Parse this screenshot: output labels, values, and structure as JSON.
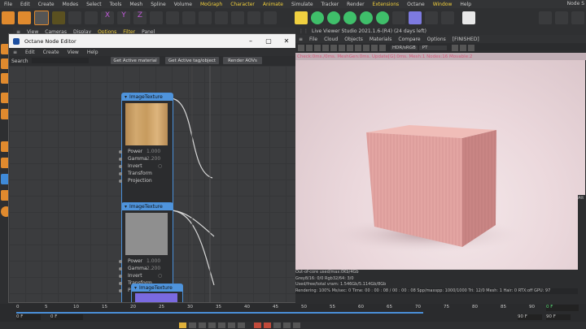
{
  "app": {
    "menu": [
      "File",
      "Edit",
      "Create",
      "Modes",
      "Select",
      "Tools",
      "Mesh",
      "Spline",
      "Volume",
      "MoGraph",
      "Character",
      "Animate",
      "Simulate",
      "Tracker",
      "Render",
      "Extensions",
      "Octane",
      "Window",
      "Help"
    ],
    "menu_highlighted": [
      "MoGraph",
      "Character",
      "Animate",
      "Extensions",
      "Window"
    ],
    "node_label": "Node S",
    "viewport_menu": [
      "View",
      "Cameras",
      "Display",
      "Options",
      "Filter",
      "Panel"
    ]
  },
  "node_editor": {
    "title": "Octane Node Editor",
    "window_buttons": [
      "–",
      "▢",
      "✕"
    ],
    "menu": [
      "Edit",
      "Create",
      "View",
      "Help"
    ],
    "search_label": "Search",
    "buttons": [
      "Get Active material",
      "Get Active tag/object",
      "Render AOVs"
    ],
    "nodes": [
      {
        "header": "ImageTexture",
        "params": [
          {
            "label": "Power",
            "value": "1.000"
          },
          {
            "label": "Gamma",
            "value": "2.200"
          },
          {
            "label": "Invert",
            "value": "○"
          },
          {
            "label": "Transform",
            "value": ""
          },
          {
            "label": "Projection",
            "value": ""
          }
        ]
      },
      {
        "header": "ImageTexture",
        "params": [
          {
            "label": "Power",
            "value": "1.000"
          },
          {
            "label": "Gamma",
            "value": "2.200"
          },
          {
            "label": "Invert",
            "value": "○"
          },
          {
            "label": "Transform",
            "value": ""
          },
          {
            "label": "P",
            "value": ""
          }
        ]
      },
      {
        "header": "ImageTexture",
        "params": []
      }
    ]
  },
  "viewer": {
    "title": "Live Viewer Studio 2021.1.6-(R4) (24 days left)",
    "menu": [
      "File",
      "Cloud",
      "Objects",
      "Materials",
      "Compare",
      "Options"
    ],
    "status_tag": "[FINISHED]",
    "colorspace": "HDR/sRGB",
    "pt": "PT",
    "check": "Check:0ms./0ms. MeshGen:0ms. Update[G]:0ms. Mesh:1 Nodes:16 Movable:2",
    "info": [
      "Out-of-core used/max:0Kb/4Gb",
      "Grey8/16: 0/0      Rgb32/64: 3/0",
      "Used/free/total vram: 1.546Gb/5.114Gb/8Gb",
      "Rendering: 100%  Ms/sec: 0   Time: 00 : 00 : 08 / 00 : 00 : 08     Spp/maxspp: 1000/1000    Tri: 12/0     Mesh: 1  Hair: 0    RTX:off     GPU:  97"
    ]
  },
  "timeline": {
    "ticks": [
      "0",
      "5",
      "10",
      "15",
      "20",
      "25",
      "30",
      "35",
      "40",
      "45",
      "50",
      "55",
      "60",
      "65",
      "70",
      "75",
      "80",
      "85",
      "90"
    ],
    "start": "0 F",
    "field_left": "0 F",
    "field_right": "90 F",
    "field_right2": "90 F",
    "current": "0 F"
  },
  "right_panel": {
    "label": "Att"
  },
  "colors": {
    "accent": "#4f94dc",
    "highlight": "#f4d23c",
    "cube": "#e2a3a0",
    "render_bg": "#ebd8dc"
  }
}
